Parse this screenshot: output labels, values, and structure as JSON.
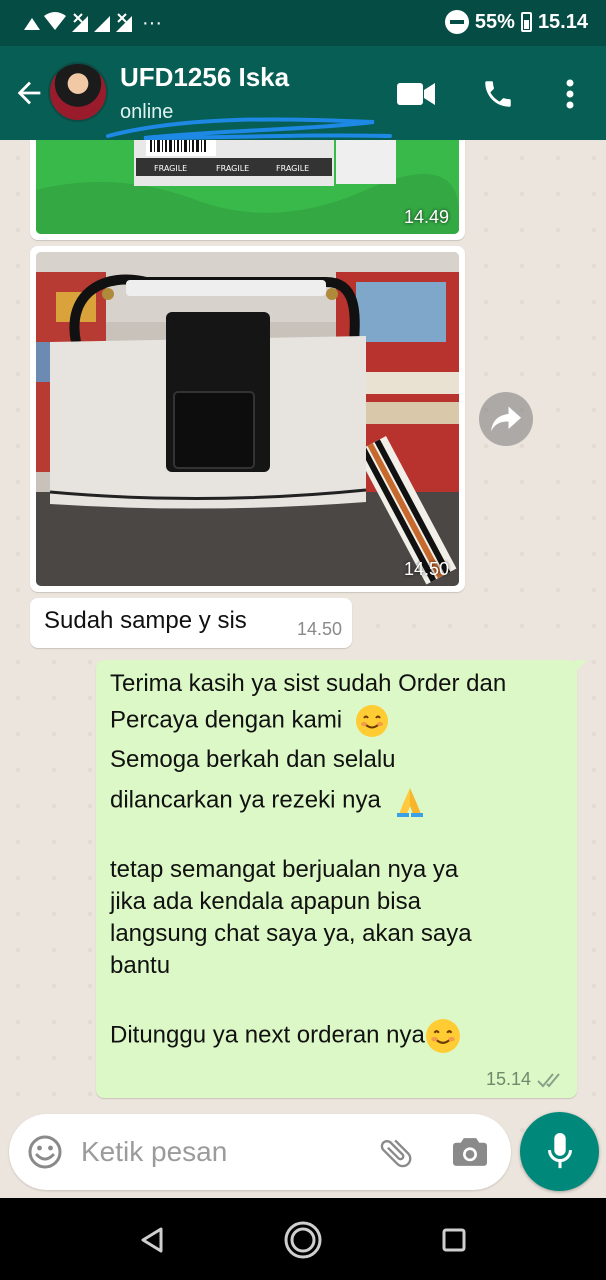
{
  "status_bar": {
    "notification_glyph": "···",
    "battery_percent": "55%",
    "time": "15.14"
  },
  "header": {
    "contact_name": "UFD1256 Iska",
    "status": "online",
    "icons": [
      "back-arrow-icon",
      "video-call-icon",
      "phone-icon",
      "more-vert-icon"
    ]
  },
  "messages": [
    {
      "type": "image",
      "direction": "in",
      "time": "14.49",
      "description_labels": [
        "FRAGILE",
        "FRAGILE",
        "FRAGILE"
      ]
    },
    {
      "type": "image",
      "direction": "in",
      "time": "14.50"
    },
    {
      "type": "text",
      "direction": "in",
      "text": "Sudah sampe y sis",
      "time": "14.50"
    },
    {
      "type": "text",
      "direction": "out",
      "time": "15.14",
      "status": "read-double-check",
      "lines": [
        "Terima kasih ya sist sudah Order dan",
        "Percaya dengan kami",
        "Semoga berkah dan selalu",
        "dilancarkan ya rezeki nya",
        "tetap semangat berjualan nya ya",
        "jika ada kendala apapun bisa",
        "langsung chat saya ya, akan saya",
        "bantu",
        "Ditunggu ya next orderan nya"
      ],
      "emojis": [
        "smiling-face-emoji",
        "folded-hands-emoji",
        "smiling-face-emoji"
      ]
    }
  ],
  "composer": {
    "placeholder": "Ketik pesan",
    "icons": [
      "emoji-icon",
      "attach-icon",
      "camera-icon",
      "mic-icon"
    ]
  },
  "colors": {
    "header": "#075e54",
    "status_bar": "#054d44",
    "outgoing_bubble": "#dcf8c6",
    "incoming_bubble": "#ffffff",
    "fab": "#00897b"
  }
}
